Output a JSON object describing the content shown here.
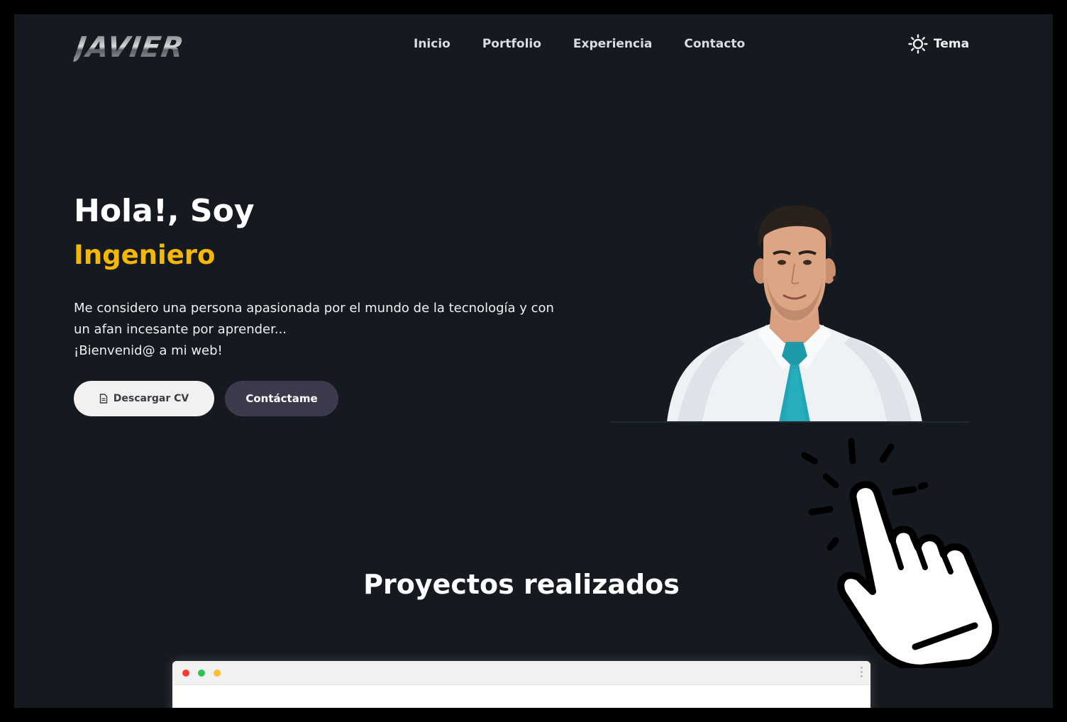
{
  "header": {
    "logo": "JAVIER",
    "nav": [
      "Inicio",
      "Portfolio",
      "Experiencia",
      "Contacto"
    ],
    "theme_label": "Tema",
    "theme_icon": "sun-icon"
  },
  "hero": {
    "greeting": "Hola!, Soy",
    "role": "Ingeniero",
    "description_line1": "Me considero una persona apasionada por el mundo de la tecnología y con",
    "description_line2": "un afan incesante por aprender...",
    "description_line3": "¡Bienvenid@ a mi web!",
    "download_cv_label": "Descargar CV",
    "download_cv_icon": "document-icon",
    "contact_label": "Contáctame"
  },
  "projects": {
    "title": "Proyectos realizados"
  },
  "colors": {
    "background": "#151a20",
    "accent": "#f5b700",
    "contact_button": "#3e3a4d"
  }
}
